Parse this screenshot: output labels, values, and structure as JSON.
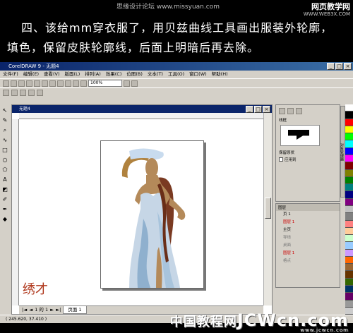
{
  "watermark_top": "思缘设计论坛 www.missyuan.com",
  "watermark_tr_line1": "网页教学网",
  "watermark_tr_line2": "WWW.WEB3X.COM",
  "instruction": {
    "line1": "四、该给mm穿衣服了，用贝兹曲线工具画出服装外轮廓，",
    "line2": "填色，保留皮肤轮廓线，后面上明暗后再去除。"
  },
  "app": {
    "title": "CorelDRAW 9 - 无题4",
    "menus": [
      "文件(F)",
      "编辑(E)",
      "查看(V)",
      "版面(L)",
      "排列(A)",
      "效果(C)",
      "位图(B)",
      "文本(T)",
      "工具(O)",
      "窗口(W)",
      "帮助(H)"
    ],
    "zoom_value": "100%",
    "doc_title": "无题4",
    "page_nav_text": "1 的 1",
    "page_tab_label": "页面 1",
    "status_text": "( 245.620, 37.410 )",
    "calligraphy": "绣才",
    "docker": {
      "outline_label": "线框",
      "keep_proportions": "保留原状",
      "apply_to_objects": "应用到",
      "layers_title": "图层",
      "pages": [
        {
          "label": "页 1",
          "color_tag": ""
        },
        {
          "label": "图层 1",
          "color_tag": "#cc0000"
        },
        {
          "label": "主页",
          "color_tag": ""
        },
        {
          "label": "导线",
          "color_tag": "#777"
        },
        {
          "label": "桌面",
          "color_tag": "#777"
        },
        {
          "label": "图层 1",
          "color_tag": "#cc0000"
        },
        {
          "label": "格点",
          "color_tag": "#777"
        }
      ],
      "side_tab": "对象管理器"
    },
    "palette": [
      "#ffffff",
      "#000000",
      "#ff0000",
      "#ffff00",
      "#00ff00",
      "#00ffff",
      "#0000ff",
      "#ff00ff",
      "#800000",
      "#808000",
      "#008000",
      "#008080",
      "#000080",
      "#800080",
      "#c0c0c0",
      "#808080",
      "#ff8080",
      "#ffcc99",
      "#ccffcc",
      "#99ccff",
      "#cc99ff",
      "#ff6600",
      "#996633",
      "#663300",
      "#336600",
      "#003366",
      "#660066",
      "#999999",
      "#cccccc"
    ]
  },
  "watermark_bottom": "JCWcn.com",
  "watermark_bottom_cn": "中国教程网",
  "watermark_bottom_small": "www.jcwcn.com"
}
